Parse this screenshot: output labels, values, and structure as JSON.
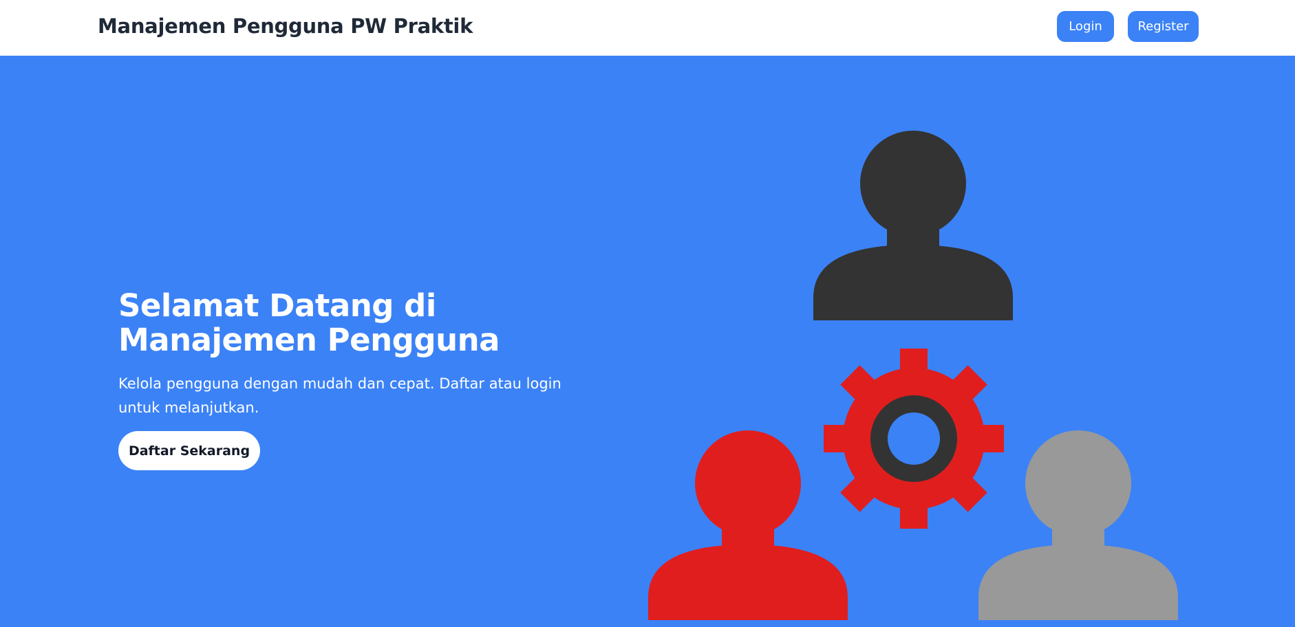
{
  "navbar": {
    "brand": "Manajemen Pengguna PW Praktik",
    "login_label": "Login",
    "register_label": "Register"
  },
  "hero": {
    "title": "Selamat Datang di Manajemen Pengguna",
    "subtitle": "Kelola pengguna dengan mudah dan cepat. Daftar atau login untuk melanjutkan.",
    "cta_label": "Daftar Sekarang"
  },
  "illustration": {
    "icons": [
      "user-icon-dark",
      "gear-icon",
      "user-icon-red",
      "user-icon-gray"
    ]
  },
  "colors": {
    "accent": "#3b82f6",
    "dark_user": "#333333",
    "red_user": "#e01e1e",
    "gray_user": "#999999",
    "gear": "#e01e1e",
    "gear_ring": "#333333"
  }
}
